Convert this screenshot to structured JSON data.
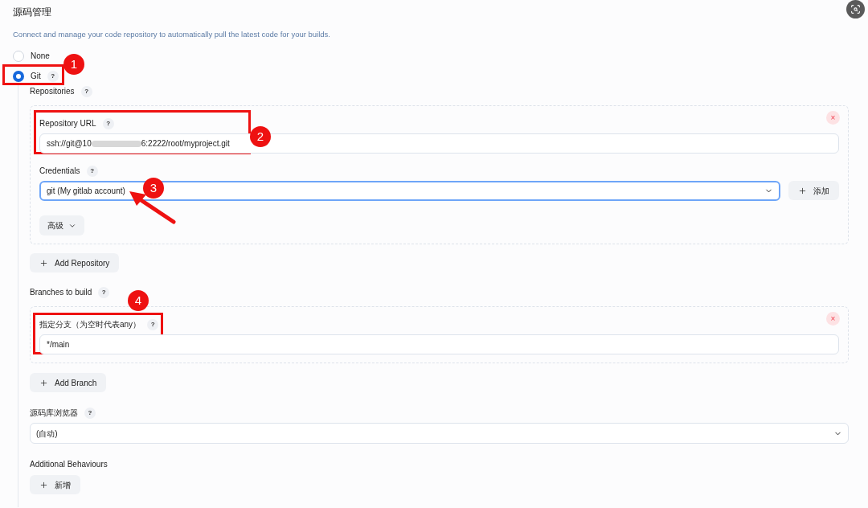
{
  "section": {
    "title": "源码管理",
    "description": "Connect and manage your code repository to automatically pull the latest code for your builds."
  },
  "scm_options": [
    {
      "label": "None",
      "selected": false
    },
    {
      "label": "Git",
      "selected": true,
      "help": "?"
    }
  ],
  "repositories": {
    "label": "Repositories",
    "help": "?",
    "url": {
      "label": "Repository URL",
      "help": "?",
      "value_start": "ssh://git@10",
      "value_end": "6:2222/root/myproject.git"
    },
    "credentials": {
      "label": "Credentials",
      "help": "?",
      "value": "git (My gitlab account)",
      "add_button": "添加"
    },
    "advanced_button": "高级",
    "remove": "×",
    "add_button": "Add Repository"
  },
  "branches": {
    "label": "Branches to build",
    "help": "?",
    "branch_label": "指定分支（为空时代表any）",
    "branch_help": "?",
    "value": "*/main",
    "remove": "×",
    "add_button": "Add Branch"
  },
  "browser": {
    "label": "源码库浏览器",
    "help": "?",
    "value": "(自动)"
  },
  "behaviours": {
    "label": "Additional Behaviours",
    "add_button": "新增"
  },
  "annotations": [
    "1",
    "2",
    "3",
    "4"
  ]
}
